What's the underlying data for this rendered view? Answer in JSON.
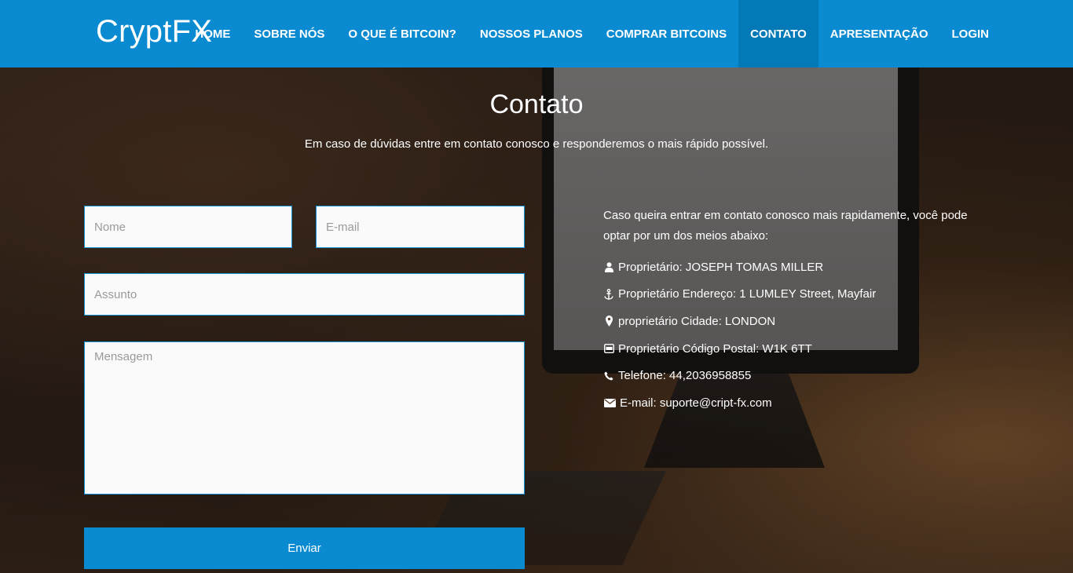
{
  "brand": "CryptFX",
  "nav": {
    "items": [
      {
        "label": "HOME",
        "active": false
      },
      {
        "label": "SOBRE NÓS",
        "active": false
      },
      {
        "label": "O QUE É BITCOIN?",
        "active": false
      },
      {
        "label": "NOSSOS PLANOS",
        "active": false
      },
      {
        "label": "COMPRAR BITCOINS",
        "active": false
      },
      {
        "label": "CONTATO",
        "active": true
      },
      {
        "label": "APRESENTAÇÃO",
        "active": false
      },
      {
        "label": "LOGIN",
        "active": false
      }
    ]
  },
  "page": {
    "title": "Contato",
    "subtitle": "Em caso de dúvidas entre em contato conosco e responderemos o mais rápido possível."
  },
  "form": {
    "name_placeholder": "Nome",
    "email_placeholder": "E-mail",
    "subject_placeholder": "Assunto",
    "message_placeholder": "Mensagem",
    "submit_label": "Enviar"
  },
  "info": {
    "intro": "Caso queira entrar em contato conosco mais rapidamente, você pode optar por um dos meios abaixo:",
    "rows": [
      {
        "icon": "user-icon",
        "text": "Proprietário: JOSEPH TOMAS MILLER"
      },
      {
        "icon": "anchor-icon",
        "text": "Proprietário Endereço: 1 LUMLEY Street, Mayfair"
      },
      {
        "icon": "map-marker-icon",
        "text": "proprietário Cidade: LONDON"
      },
      {
        "icon": "mailbox-icon",
        "text": "Proprietário Código Postal: W1K 6TT"
      },
      {
        "icon": "phone-icon",
        "text": "Telefone: 44,2036958855"
      },
      {
        "icon": "envelope-icon",
        "text": "E-mail: suporte@cript-fx.com"
      }
    ]
  },
  "colors": {
    "primary": "#0a8ad0",
    "nav_active": "#0479b7",
    "field_border": "#1493d6"
  }
}
